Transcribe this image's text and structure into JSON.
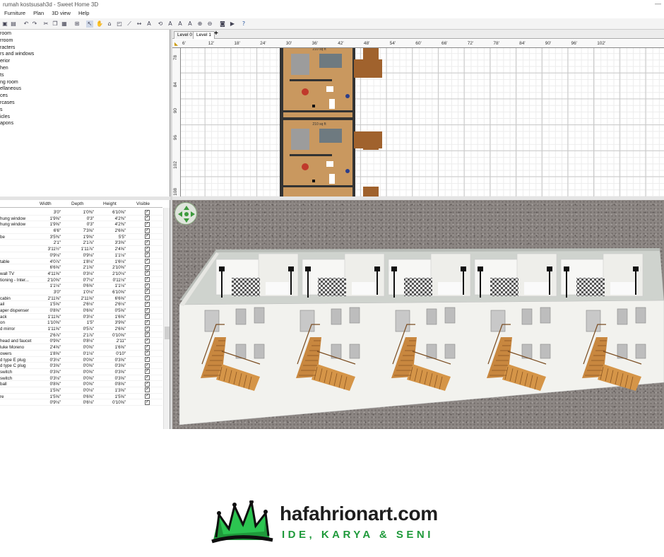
{
  "window": {
    "title": "rumah kostsusah3d - Sweet Home 3D",
    "controls": "—"
  },
  "menu": [
    "Furniture",
    "Plan",
    "3D view",
    "Help"
  ],
  "catalog": {
    "categories": [
      "room",
      "rroom",
      "racters",
      "rs and windows",
      "erior",
      "hen",
      "ts",
      "ng room",
      "ellaneous",
      "ces",
      "rcases",
      "s",
      "icles",
      "apons"
    ]
  },
  "furniture_table": {
    "columns": [
      "Width",
      "Depth",
      "Height",
      "Visible"
    ],
    "rows": [
      {
        "name": "",
        "width": "3'0\"",
        "depth": "1'0⅜\"",
        "height": "6'10⅝\""
      },
      {
        "name": "hung window",
        "width": "1'9⅝\"",
        "depth": "0'3\"",
        "height": "4'2⅜\""
      },
      {
        "name": "hung window",
        "width": "1'9⅝\"",
        "depth": "0'3\"",
        "height": "4'2⅜\""
      },
      {
        "name": "",
        "width": "6'6\"",
        "depth": "7'3⅝\"",
        "height": "2'6⅝\""
      },
      {
        "name": "be",
        "width": "3'5⅜\"",
        "depth": "1'9⅝\"",
        "height": "5'5\""
      },
      {
        "name": "",
        "width": "2'1\"",
        "depth": "2'1⅞\"",
        "height": "3'3⅝\""
      },
      {
        "name": "",
        "width": "3'11½\"",
        "depth": "1'11⅞\"",
        "height": "2'4⅝\""
      },
      {
        "name": "",
        "width": "0'9⅛\"",
        "depth": "0'9⅛\"",
        "height": "1'1⅛\""
      },
      {
        "name": "table",
        "width": "4'0⅞\"",
        "depth": "1'8⅛\"",
        "height": "1'6⅛\""
      },
      {
        "name": "",
        "width": "6'6⅝\"",
        "depth": "2'1⅝\"",
        "height": "2'10⅝\""
      },
      {
        "name": "wall TV",
        "width": "4'11⅝\"",
        "depth": "0'3⅛\"",
        "height": "2'10⅛\""
      },
      {
        "name": "tioning - Inter...",
        "width": "2'10⅝\"",
        "depth": "0'7⅛\"",
        "height": "0'11⅛\""
      },
      {
        "name": "",
        "width": "1'1⅛\"",
        "depth": "0'6⅝\"",
        "height": "1'1⅛\""
      },
      {
        "name": "",
        "width": "3'0\"",
        "depth": "1'0⅛\"",
        "height": "6'10⅝\""
      },
      {
        "name": "cabin",
        "width": "2'11⅝\"",
        "depth": "2'11⅝\"",
        "height": "6'6⅝\""
      },
      {
        "name": "ail",
        "width": "1'5⅝\"",
        "depth": "2'6⅛\"",
        "height": "2'6⅛\""
      },
      {
        "name": "aper dispenser",
        "width": "0'8⅝\"",
        "depth": "0'6⅝\"",
        "height": "0'5⅝\""
      },
      {
        "name": "ack",
        "width": "1'11⅝\"",
        "depth": "0'3⅛\"",
        "height": "1'6⅝\""
      },
      {
        "name": "on",
        "width": "1'10⅝\"",
        "depth": "1'5\"",
        "height": "3'9⅝\""
      },
      {
        "name": "d mirror",
        "width": "1'11⅝\"",
        "depth": "0'5⅞\"",
        "height": "2'6⅝\""
      },
      {
        "name": "",
        "width": "2'6⅞\"",
        "depth": "2'1⅞\"",
        "height": "0'10⅝\""
      },
      {
        "name": "head and faucet",
        "width": "0'9⅝\"",
        "depth": "0'8⅛\"",
        "height": "2'11\""
      },
      {
        "name": "luke Moreno",
        "width": "2'4⅝\"",
        "depth": "0'0⅝\"",
        "height": "1'6⅝\""
      },
      {
        "name": "owers",
        "width": "1'8⅝\"",
        "depth": "0'1⅛\"",
        "height": "0'10\""
      },
      {
        "name": "d type E plug",
        "width": "0'3⅛\"",
        "depth": "0'0⅝\"",
        "height": "0'3⅝\""
      },
      {
        "name": "d type C plug",
        "width": "0'3⅝\"",
        "depth": "0'0⅝\"",
        "height": "0'3⅝\""
      },
      {
        "name": "switch",
        "width": "0'3⅝\"",
        "depth": "0'0⅝\"",
        "height": "0'3⅝\""
      },
      {
        "name": "switch",
        "width": "0'3⅛\"",
        "depth": "0'0⅝\"",
        "height": "0'3⅝\""
      },
      {
        "name": "ball",
        "width": "0'8⅝\"",
        "depth": "0'0⅝\"",
        "height": "0'8⅝\""
      },
      {
        "name": "",
        "width": "1'5⅝\"",
        "depth": "0'0⅛\"",
        "height": "1'3⅝\""
      },
      {
        "name": "re",
        "width": "1'5⅝\"",
        "depth": "0'6⅝\"",
        "height": "1'5⅝\""
      },
      {
        "name": "",
        "width": "0'9⅛\"",
        "depth": "0'6⅛\"",
        "height": "0'10⅝\""
      }
    ]
  },
  "plan": {
    "levels": [
      "Level 0",
      "Level 1"
    ],
    "add_level": "+",
    "ruler_x": [
      "0'",
      "6'",
      "12'",
      "18'",
      "24'",
      "30'",
      "36'",
      "42'",
      "48'",
      "54'",
      "60'",
      "66'",
      "72'",
      "78'",
      "84'",
      "90'",
      "96'",
      "102'"
    ],
    "ruler_x_first": "6'",
    "ruler_y": [
      "78",
      "84",
      "90",
      "96",
      "102",
      "108"
    ],
    "room_label": "210 sq ft"
  },
  "colors": {
    "accent": "#1f9a3b",
    "floor": "#c9985f",
    "gravel": "#8c8683"
  },
  "brand": {
    "name": "hafahrionart.com",
    "tagline": "IDE, KARYA & SENI"
  }
}
